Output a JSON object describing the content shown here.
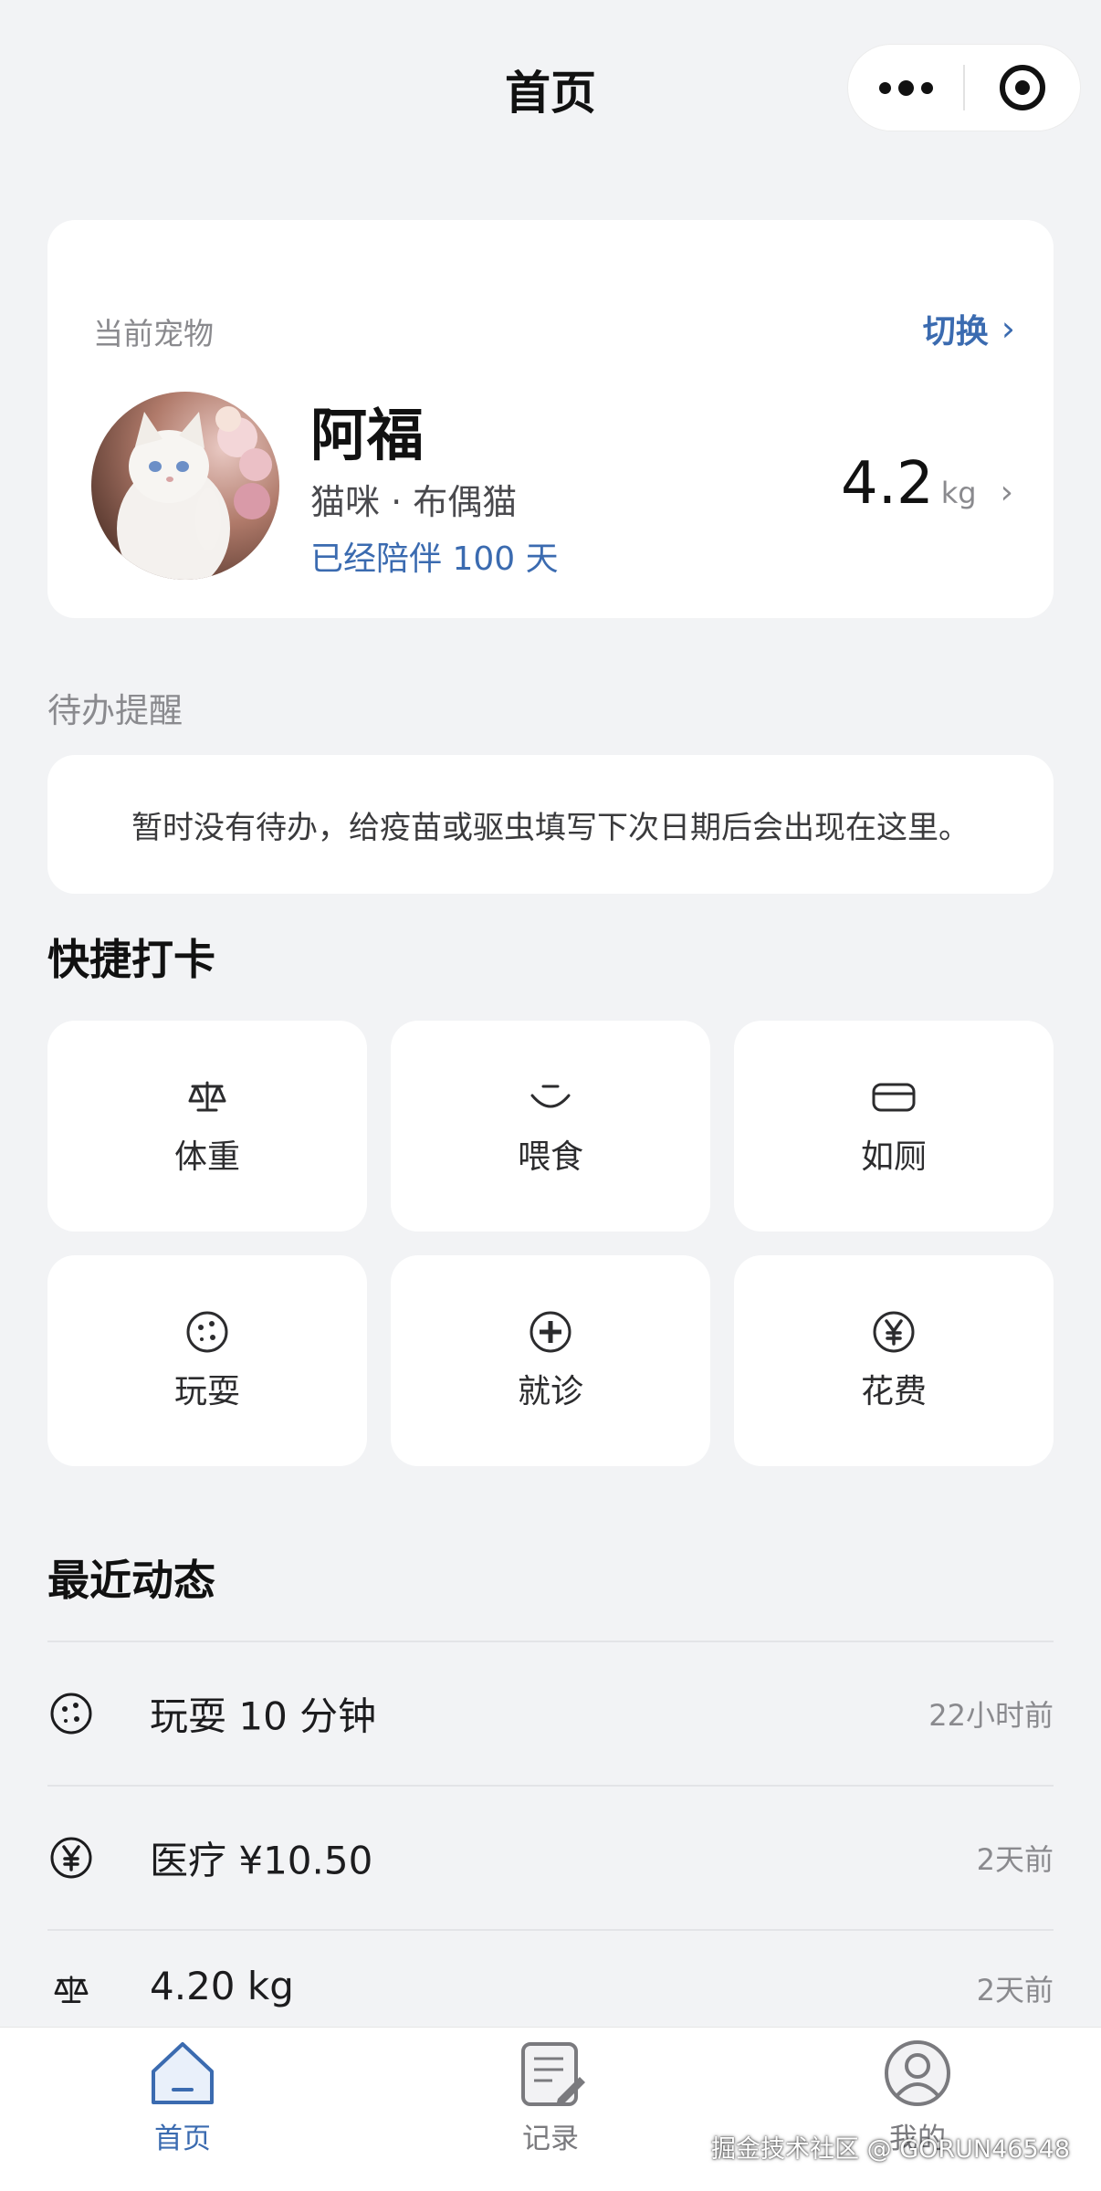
{
  "nav": {
    "title": "首页"
  },
  "pet_card": {
    "label": "当前宠物",
    "switch_label": "切换",
    "name": "阿福",
    "breed": "猫咪 · 布偶猫",
    "days": "已经陪伴 100 天",
    "weight": "4.2",
    "weight_unit": "kg"
  },
  "todo": {
    "section_label": "待办提醒",
    "empty_text": "暂时没有待办，给疫苗或驱虫填写下次日期后会出现在这里。"
  },
  "quick": {
    "title": "快捷打卡",
    "items": [
      {
        "label": "体重",
        "icon": "scale-icon"
      },
      {
        "label": "喂食",
        "icon": "bowl-icon"
      },
      {
        "label": "如厕",
        "icon": "litter-box-icon"
      },
      {
        "label": "玩耍",
        "icon": "ball-icon"
      },
      {
        "label": "就诊",
        "icon": "medical-plus-icon"
      },
      {
        "label": "花费",
        "icon": "yen-icon"
      }
    ]
  },
  "recent": {
    "title": "最近动态",
    "items": [
      {
        "icon": "ball-icon",
        "title": "玩耍 10 分钟",
        "time": "22小时前"
      },
      {
        "icon": "yen-icon",
        "title": "医疗 ¥10.50",
        "time": "2天前"
      },
      {
        "icon": "scale-icon",
        "title": "4.20 kg",
        "time": "2天前"
      }
    ]
  },
  "tabbar": {
    "items": [
      {
        "label": "首页",
        "icon": "home-icon",
        "active": true
      },
      {
        "label": "记录",
        "icon": "record-icon",
        "active": false
      },
      {
        "label": "我的",
        "icon": "profile-icon",
        "active": false
      }
    ]
  },
  "watermark": "掘金技术社区 @ GORUN46548",
  "colors": {
    "accent": "#3b6bb0",
    "background": "#f2f3f5",
    "card": "#ffffff",
    "muted": "#8a8a8e"
  }
}
